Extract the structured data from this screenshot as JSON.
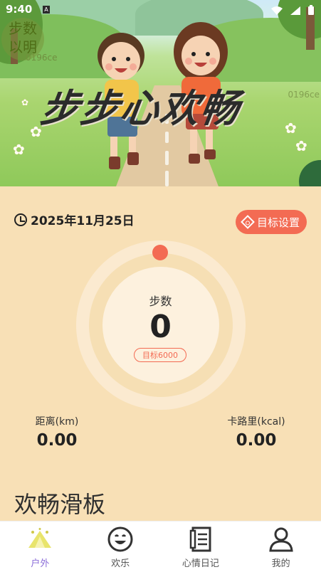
{
  "status_bar": {
    "time": "9:40",
    "notif": "A"
  },
  "hero": {
    "title": "步步心欢畅",
    "float_button": "步数\n以明",
    "watermark_left": "0196ce",
    "watermark_right": "0196ce"
  },
  "date": {
    "text": "2025年11月25日"
  },
  "goal_button": {
    "label": "目标设置"
  },
  "steps": {
    "label": "步数",
    "value": "0",
    "target": "目标6000"
  },
  "stats": {
    "distance": {
      "label": "距离(km)",
      "value": "0.00"
    },
    "calories": {
      "label": "卡路里(kcal)",
      "value": "0.00"
    }
  },
  "section": {
    "title": "欢畅滑板"
  },
  "nav": {
    "items": [
      {
        "label": "户外",
        "icon": "tent-icon",
        "active": true
      },
      {
        "label": "欢乐",
        "icon": "smile-icon",
        "active": false
      },
      {
        "label": "心情日记",
        "icon": "notebook-icon",
        "active": false
      },
      {
        "label": "我的",
        "icon": "user-icon",
        "active": false
      }
    ]
  },
  "colors": {
    "accent": "#f36b53",
    "nav_active": "#8a6cd8",
    "background": "#f8e0b6"
  }
}
